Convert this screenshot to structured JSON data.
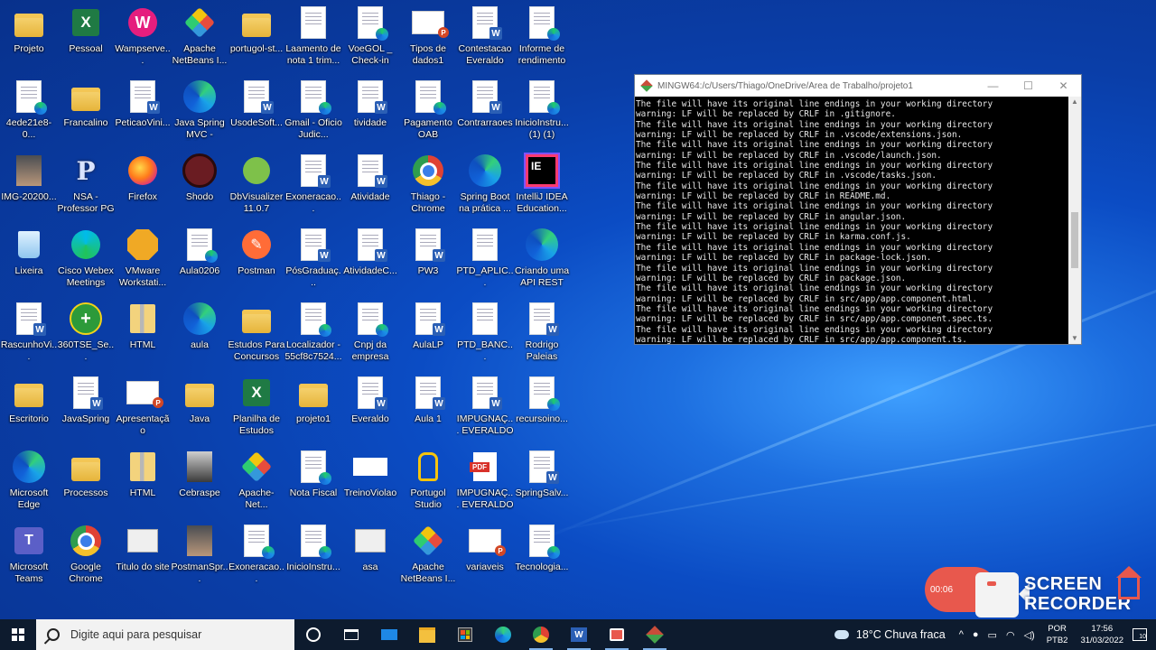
{
  "desktop": {
    "icons": [
      {
        "label": "Projeto",
        "glyph": "folder"
      },
      {
        "label": "Pessoal",
        "glyph": "excel"
      },
      {
        "label": "Wampserve...",
        "glyph": "wamp"
      },
      {
        "label": "Apache NetBeans I...",
        "glyph": "cube"
      },
      {
        "label": "portugol-st...",
        "glyph": "folder"
      },
      {
        "label": "Laamento de nota 1  trim...",
        "glyph": "doc"
      },
      {
        "label": "VoeGOL _ Check-in",
        "glyph": "doc-edge"
      },
      {
        "label": "Tipos de dados1",
        "glyph": "ppt"
      },
      {
        "label": "Contestacao Everaldo",
        "glyph": "doc-word"
      },
      {
        "label": "Informe de rendimento",
        "glyph": "doc-edge"
      },
      {
        "label": "4ede21e8-0...",
        "glyph": "doc-edge"
      },
      {
        "label": "Francalino",
        "glyph": "folder"
      },
      {
        "label": "PeticaoVini...",
        "glyph": "doc-word"
      },
      {
        "label": "Java Spring MVC - Crian...",
        "glyph": "edge"
      },
      {
        "label": "UsodeSoft...",
        "glyph": "doc-word"
      },
      {
        "label": "Gmail - Oficio Judic...",
        "glyph": "doc-edge"
      },
      {
        "label": "tividade",
        "glyph": "doc-word"
      },
      {
        "label": "Pagamento OAB",
        "glyph": "doc-edge"
      },
      {
        "label": "Contrarraoes",
        "glyph": "doc-word"
      },
      {
        "label": "InicioInstru... (1) (1)",
        "glyph": "doc-edge"
      },
      {
        "label": "IMG-20200...",
        "glyph": "photo"
      },
      {
        "label": "NSA - Professor PG",
        "glyph": "p"
      },
      {
        "label": "Firefox",
        "glyph": "firefox"
      },
      {
        "label": "Shodo",
        "glyph": "shodo"
      },
      {
        "label": "DbVisualizer 11.0.7",
        "glyph": "dbv"
      },
      {
        "label": "Exoneracao...",
        "glyph": "doc-word"
      },
      {
        "label": "Atividade",
        "glyph": "doc-word"
      },
      {
        "label": "Thiago - Chrome",
        "glyph": "chrome"
      },
      {
        "label": "Spring Boot na prática ...",
        "glyph": "edge"
      },
      {
        "label": "IntelliJ IDEA Education...",
        "glyph": "ij"
      },
      {
        "label": "Lixeira",
        "glyph": "trash"
      },
      {
        "label": "Cisco Webex Meetings",
        "glyph": "webex"
      },
      {
        "label": "VMware Workstati...",
        "glyph": "vmware"
      },
      {
        "label": "Aula0206",
        "glyph": "doc-edge"
      },
      {
        "label": "Postman",
        "glyph": "postman"
      },
      {
        "label": "PósGraduaç...",
        "glyph": "doc-word"
      },
      {
        "label": "AtividadeC...",
        "glyph": "doc-word"
      },
      {
        "label": "PW3",
        "glyph": "doc-word"
      },
      {
        "label": "PTD_APLIC...",
        "glyph": "blank"
      },
      {
        "label": "Criando uma API REST co...",
        "glyph": "edge"
      },
      {
        "label": "RascunhoVi...",
        "glyph": "doc-word"
      },
      {
        "label": "360TSE_Se...",
        "glyph": "360"
      },
      {
        "label": "HTML",
        "glyph": "zip"
      },
      {
        "label": "aula",
        "glyph": "edge"
      },
      {
        "label": "Estudos Para Concursos",
        "glyph": "folder"
      },
      {
        "label": "Localizador - 55cf8c7524...",
        "glyph": "doc-edge"
      },
      {
        "label": "Cnpj da empresa",
        "glyph": "doc-edge"
      },
      {
        "label": "AulaLP",
        "glyph": "doc-word"
      },
      {
        "label": "PTD_BANC...",
        "glyph": "blank"
      },
      {
        "label": "Rodrigo Paleias",
        "glyph": "doc-word"
      },
      {
        "label": "Escritorio",
        "glyph": "folder"
      },
      {
        "label": "JavaSpring",
        "glyph": "doc-word"
      },
      {
        "label": "Apresentação",
        "glyph": "ppt"
      },
      {
        "label": "Java",
        "glyph": "folder"
      },
      {
        "label": "Planilha de Estudos",
        "glyph": "excel"
      },
      {
        "label": "projeto1",
        "glyph": "folder"
      },
      {
        "label": "Everaldo",
        "glyph": "doc-word"
      },
      {
        "label": "Aula 1",
        "glyph": "doc-word"
      },
      {
        "label": "IMPUGNAÇ... EVERALDO",
        "glyph": "doc-word"
      },
      {
        "label": "recursoino...",
        "glyph": "doc-edge"
      },
      {
        "label": "Microsoft Edge",
        "glyph": "edge"
      },
      {
        "label": "Processos",
        "glyph": "folder"
      },
      {
        "label": "HTML",
        "glyph": "zip"
      },
      {
        "label": "Cebraspe",
        "glyph": "face"
      },
      {
        "label": "Apache-Net...",
        "glyph": "cube"
      },
      {
        "label": "Nota Fiscal",
        "glyph": "doc-edge"
      },
      {
        "label": "TreinoViolao",
        "glyph": "guitar"
      },
      {
        "label": "Portugol Studio",
        "glyph": "bulb"
      },
      {
        "label": "IMPUGNAÇ... EVERALDO",
        "glyph": "pdf"
      },
      {
        "label": "SpringSalv...",
        "glyph": "doc-word"
      },
      {
        "label": "Microsoft Teams",
        "glyph": "teams"
      },
      {
        "label": "Google Chrome",
        "glyph": "chrome"
      },
      {
        "label": "Titulo do site",
        "glyph": "pg"
      },
      {
        "label": "PostmanSpr...",
        "glyph": "photo"
      },
      {
        "label": "Exoneracao...",
        "glyph": "doc-edge"
      },
      {
        "label": "InicioInstru...",
        "glyph": "doc-edge"
      },
      {
        "label": "asa",
        "glyph": "pg"
      },
      {
        "label": "Apache NetBeans I...",
        "glyph": "cube"
      },
      {
        "label": "variaveis",
        "glyph": "ppt"
      },
      {
        "label": "Tecnologia...",
        "glyph": "doc-edge"
      }
    ]
  },
  "terminal": {
    "title": "MINGW64:/c/Users/Thiago/OneDrive/Área de Trabalho/projeto1",
    "lines": [
      "The file will have its original line endings in your working directory",
      "warning: LF will be replaced by CRLF in .gitignore.",
      "The file will have its original line endings in your working directory",
      "warning: LF will be replaced by CRLF in .vscode/extensions.json.",
      "The file will have its original line endings in your working directory",
      "warning: LF will be replaced by CRLF in .vscode/launch.json.",
      "The file will have its original line endings in your working directory",
      "warning: LF will be replaced by CRLF in .vscode/tasks.json.",
      "The file will have its original line endings in your working directory",
      "warning: LF will be replaced by CRLF in README.md.",
      "The file will have its original line endings in your working directory",
      "warning: LF will be replaced by CRLF in angular.json.",
      "The file will have its original line endings in your working directory",
      "warning: LF will be replaced by CRLF in karma.conf.js.",
      "The file will have its original line endings in your working directory",
      "warning: LF will be replaced by CRLF in package-lock.json.",
      "The file will have its original line endings in your working directory",
      "warning: LF will be replaced by CRLF in package.json.",
      "The file will have its original line endings in your working directory",
      "warning: LF will be replaced by CRLF in src/app/app.component.html.",
      "The file will have its original line endings in your working directory",
      "warning: LF will be replaced by CRLF in src/app/app.component.spec.ts.",
      "The file will have its original line endings in your working directory",
      "warning: LF will be replaced by CRLF in src/app/app.component.ts."
    ],
    "minimize_label": "—",
    "maximize_label": "☐",
    "close_label": "✕"
  },
  "recorder": {
    "timer": "00:06",
    "brand_line1": "SCREEN",
    "brand_line2": "RECORDER"
  },
  "taskbar": {
    "search_placeholder": "Digite aqui para pesquisar",
    "weather": "18°C  Chuva fraca",
    "lang_line1": "POR",
    "lang_line2": "PTB2",
    "time": "17:56",
    "date": "31/03/2022",
    "notifications": "10"
  }
}
